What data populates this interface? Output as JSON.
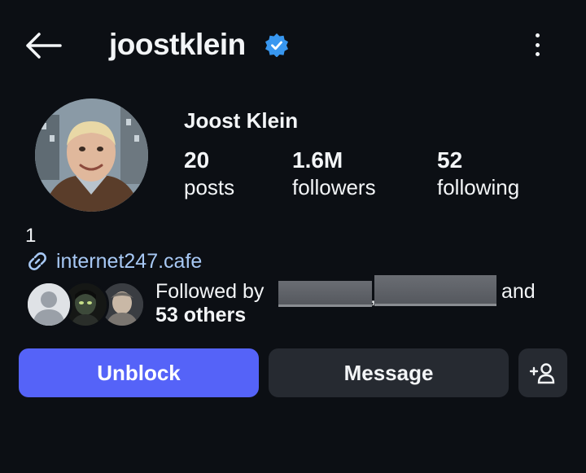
{
  "header": {
    "username": "joostklein",
    "back_icon": "arrow-left-icon",
    "verified_icon": "verified-badge-icon",
    "more_icon": "more-vertical-icon"
  },
  "profile": {
    "display_name": "Joost Klein",
    "stats": [
      {
        "value": "20",
        "label": "posts"
      },
      {
        "value": "1.6M",
        "label": "followers"
      },
      {
        "value": "52",
        "label": "following"
      }
    ],
    "bio": "1",
    "link": "internet247.cafe",
    "link_icon": "link-icon"
  },
  "followed_by": {
    "prefix": "Followed by",
    "separator": ",",
    "suffix": "and",
    "others": "53 others"
  },
  "actions": {
    "unblock": "Unblock",
    "message": "Message",
    "add_user_icon": "add-user-icon"
  },
  "colors": {
    "background": "#0c0f14",
    "accent": "#5563f8",
    "verified": "#3897f0",
    "link": "#a7c8f4",
    "button": "#262a31"
  }
}
